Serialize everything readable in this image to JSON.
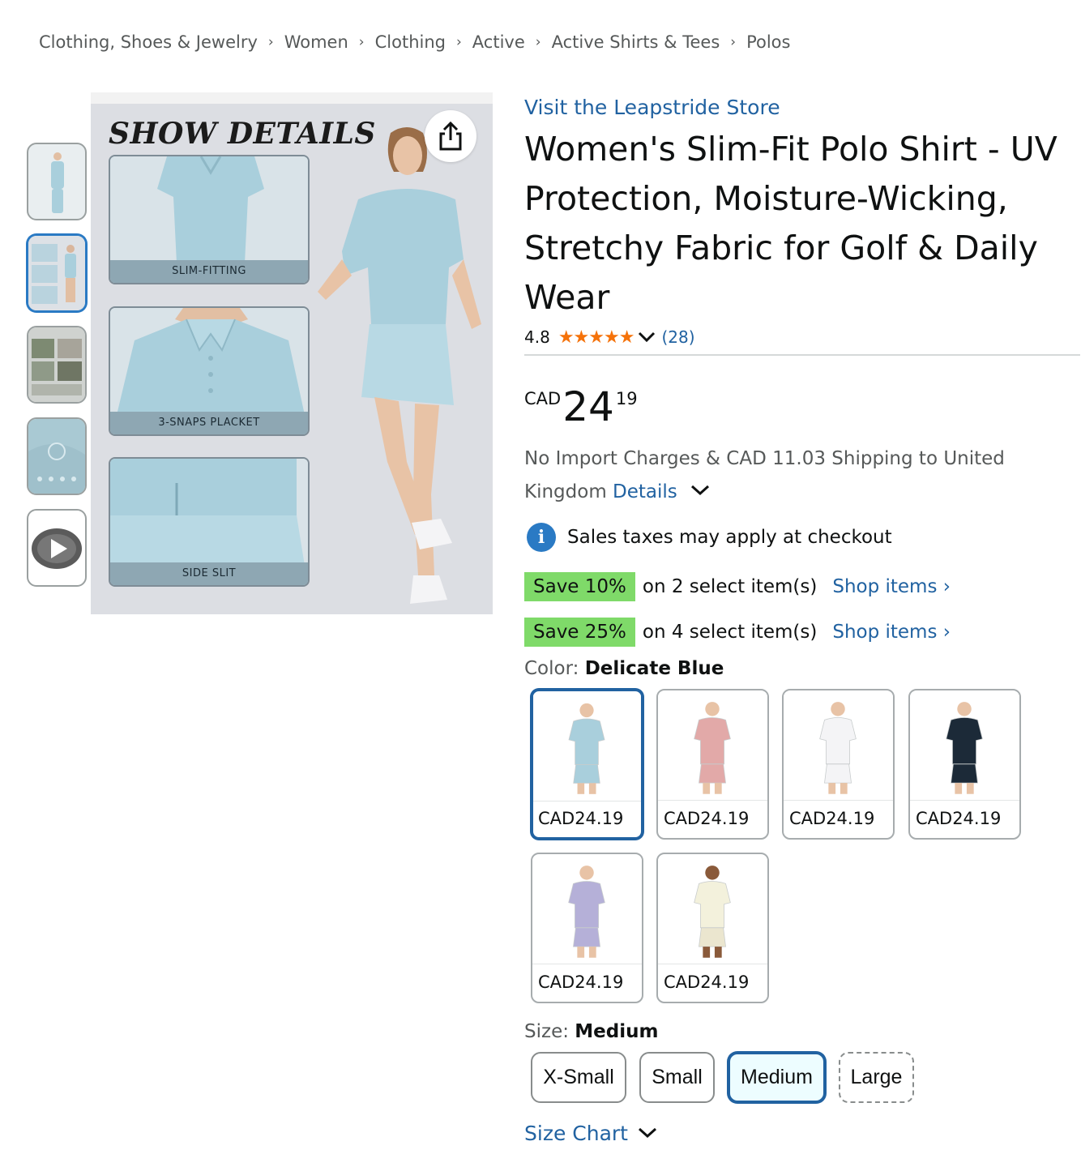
{
  "breadcrumb": [
    "Clothing, Shoes & Jewelry",
    "Women",
    "Clothing",
    "Active",
    "Active Shirts & Tees",
    "Polos"
  ],
  "breadcrumb_separator": "›",
  "gallery": {
    "headline": "SHOW DETAILS",
    "cards": [
      "SLIM-FITTING",
      "3-SNAPS PLACKET",
      "SIDE SLIT"
    ],
    "share_icon": "share-icon",
    "thumbnail_count": 5,
    "active_thumbnail": 2
  },
  "store_link": "Visit the Leapstride Store",
  "title": "Women's Slim-Fit Polo Shirt - UV Protection, Moisture-Wicking, Stretchy Fabric for Golf & Daily Wear",
  "rating": {
    "value": "4.8",
    "stars": 5,
    "count": "(28)"
  },
  "price": {
    "currency": "CAD",
    "whole": "24",
    "fraction": "19"
  },
  "shipping": {
    "text": "No Import Charges & CAD 11.03 Shipping to United Kingdom ",
    "details_link": "Details"
  },
  "tax_notice": "Sales taxes may apply at checkout",
  "promotions": [
    {
      "badge": "Save 10%",
      "text": "on 2 select item(s)",
      "link": "Shop items ›"
    },
    {
      "badge": "Save 25%",
      "text": "on 4 select item(s)",
      "link": "Shop items ›"
    }
  ],
  "color": {
    "label": "Color: ",
    "selected": "Delicate Blue",
    "swatches": [
      {
        "price": "CAD24.19",
        "shirt": "#a9cfdc",
        "bottom": "#a9cfdc",
        "skin": "#e8c3a6"
      },
      {
        "price": "CAD24.19",
        "shirt": "#e2a9a8",
        "bottom": "#e2a9a8",
        "skin": "#e8c3a6"
      },
      {
        "price": "CAD24.19",
        "shirt": "#f4f4f6",
        "bottom": "#f4f4f6",
        "skin": "#e8c3a6"
      },
      {
        "price": "CAD24.19",
        "shirt": "#1c2a38",
        "bottom": "#1c2a38",
        "skin": "#e8c3a6"
      },
      {
        "price": "CAD24.19",
        "shirt": "#b5b0d8",
        "bottom": "#b5b0d8",
        "skin": "#e8c3a6"
      },
      {
        "price": "CAD24.19",
        "shirt": "#f3f1dc",
        "bottom": "#ebe6cf",
        "skin": "#8a5a3a"
      }
    ]
  },
  "size": {
    "label": "Size: ",
    "selected": "Medium",
    "options": [
      "X-Small",
      "Small",
      "Medium",
      "Large"
    ]
  },
  "size_chart": "Size Chart",
  "colors": {
    "link": "#2162a1",
    "save_badge": "#7fda69",
    "star": "#f5720a",
    "selected_border": "#2162a1"
  }
}
